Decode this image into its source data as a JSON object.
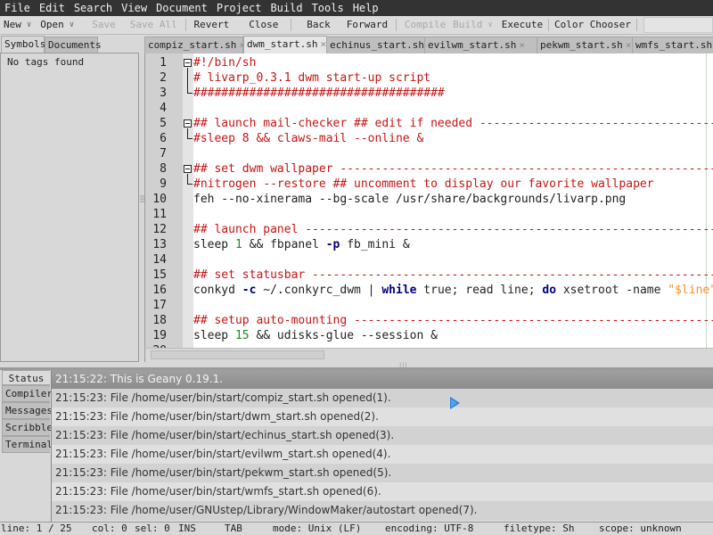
{
  "menubar": [
    "File",
    "Edit",
    "Search",
    "View",
    "Document",
    "Project",
    "Build",
    "Tools",
    "Help"
  ],
  "toolbar": {
    "new": "New",
    "open": "Open",
    "save": "Save",
    "save_all": "Save All",
    "revert": "Revert",
    "close": "Close",
    "back": "Back",
    "forward": "Forward",
    "compile": "Compile",
    "build": "Build",
    "execute": "Execute",
    "color_chooser": "Color Chooser",
    "dropdown_glyph": "∨"
  },
  "sidebar": {
    "tabs": [
      "Symbols",
      "Documents"
    ],
    "active_tab": "Symbols",
    "empty_text": "No tags found"
  },
  "editor": {
    "tabs": [
      {
        "label": "compiz_start.sh",
        "active": false
      },
      {
        "label": "dwm_start.sh",
        "active": true
      },
      {
        "label": "echinus_start.sh",
        "active": false
      },
      {
        "label": "evilwm_start.sh",
        "active": false
      },
      {
        "label": "pekwm_start.sh",
        "active": false
      },
      {
        "label": "wmfs_start.sh",
        "active": false
      }
    ],
    "close_glyph": "×",
    "lines": [
      {
        "n": "1",
        "parts": [
          {
            "t": "#!/bin/sh",
            "c": "comment"
          }
        ]
      },
      {
        "n": "2",
        "parts": [
          {
            "t": "# livarp_0.3.1 dwm start-up script",
            "c": "comment"
          }
        ]
      },
      {
        "n": "3",
        "parts": [
          {
            "t": "####################################",
            "c": "comment"
          }
        ]
      },
      {
        "n": "4",
        "parts": []
      },
      {
        "n": "5",
        "parts": [
          {
            "t": "## launch mail-checker ## edit if needed -----------------------------------------",
            "c": "comment"
          }
        ]
      },
      {
        "n": "6",
        "parts": [
          {
            "t": "#sleep 8 && claws-mail --online &",
            "c": "comment"
          }
        ]
      },
      {
        "n": "7",
        "parts": []
      },
      {
        "n": "8",
        "parts": [
          {
            "t": "## set dwm wallpaper -------------------------------------------------------------",
            "c": "comment"
          }
        ]
      },
      {
        "n": "9",
        "parts": [
          {
            "t": "#nitrogen --restore ## uncomment to display our favorite wallpaper",
            "c": "comment"
          }
        ]
      },
      {
        "n": "10",
        "parts": [
          {
            "t": "feh --no-xinerama --bg-scale /usr/share/backgrounds/livarp.png",
            "c": ""
          }
        ]
      },
      {
        "n": "11",
        "parts": []
      },
      {
        "n": "12",
        "parts": [
          {
            "t": "## launch panel ------------------------------------------------------------------",
            "c": "comment"
          }
        ]
      },
      {
        "n": "13",
        "parts": [
          {
            "t": "sleep ",
            "c": ""
          },
          {
            "t": "1",
            "c": "num"
          },
          {
            "t": " && fbpanel ",
            "c": ""
          },
          {
            "t": "-p",
            "c": "kw"
          },
          {
            "t": " fb_mini &",
            "c": ""
          }
        ]
      },
      {
        "n": "14",
        "parts": []
      },
      {
        "n": "15",
        "parts": [
          {
            "t": "## set statusbar -----------------------------------------------------------------",
            "c": "comment"
          }
        ]
      },
      {
        "n": "16",
        "parts": [
          {
            "t": "conkyd ",
            "c": ""
          },
          {
            "t": "-c",
            "c": "kw"
          },
          {
            "t": " ~/.conkyrc_dwm | ",
            "c": ""
          },
          {
            "t": "while",
            "c": "kw"
          },
          {
            "t": " true; read line; ",
            "c": ""
          },
          {
            "t": "do",
            "c": "kw"
          },
          {
            "t": " xsetroot -name ",
            "c": ""
          },
          {
            "t": "\"$line\"",
            "c": "str"
          }
        ]
      },
      {
        "n": "17",
        "parts": []
      },
      {
        "n": "18",
        "parts": [
          {
            "t": "## setup auto-mounting -----------------------------------------------------------",
            "c": "comment"
          }
        ]
      },
      {
        "n": "19",
        "parts": [
          {
            "t": "sleep ",
            "c": ""
          },
          {
            "t": "15",
            "c": "num"
          },
          {
            "t": " && udisks-glue --session &",
            "c": ""
          }
        ]
      },
      {
        "n": "20",
        "parts": []
      }
    ]
  },
  "messages": {
    "tabs": [
      "Status",
      "Compiler",
      "Messages",
      "Scribble",
      "Terminal"
    ],
    "active_tab": "Status",
    "lines": [
      "21:15:22: This is Geany 0.19.1.",
      "21:15:23: File /home/user/bin/start/compiz_start.sh opened(1).",
      "21:15:23: File /home/user/bin/start/dwm_start.sh opened(2).",
      "21:15:23: File /home/user/bin/start/echinus_start.sh opened(3).",
      "21:15:23: File /home/user/bin/start/evilwm_start.sh opened(4).",
      "21:15:23: File /home/user/bin/start/pekwm_start.sh opened(5).",
      "21:15:23: File /home/user/bin/start/wmfs_start.sh opened(6).",
      "21:15:23: File /home/user/GNUstep/Library/WindowMaker/autostart opened(7)."
    ]
  },
  "statusbar": {
    "line": "line: 1 / 25",
    "col": "col: 0",
    "sel": "sel: 0",
    "ins": "INS",
    "tab": "TAB",
    "mode": "mode: Unix (LF)",
    "encoding": "encoding: UTF-8",
    "filetype": "filetype: Sh",
    "scope": "scope: unknown"
  }
}
